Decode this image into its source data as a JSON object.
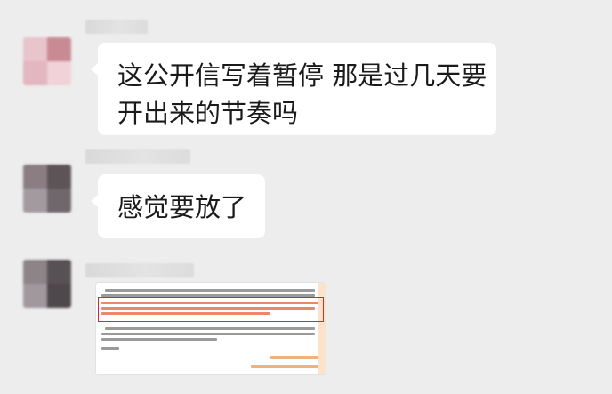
{
  "chat": {
    "messages": [
      {
        "type": "text",
        "lines": [
          "这公开信写着暂停 那是过几天要",
          "开出来的节奏吗"
        ]
      },
      {
        "type": "text",
        "lines": [
          "感觉要放了"
        ]
      },
      {
        "type": "image"
      }
    ]
  },
  "colors": {
    "background": "#ededed",
    "bubble": "#ffffff",
    "highlight_frame": "#e0262a",
    "document_accent": "#f0a060"
  }
}
